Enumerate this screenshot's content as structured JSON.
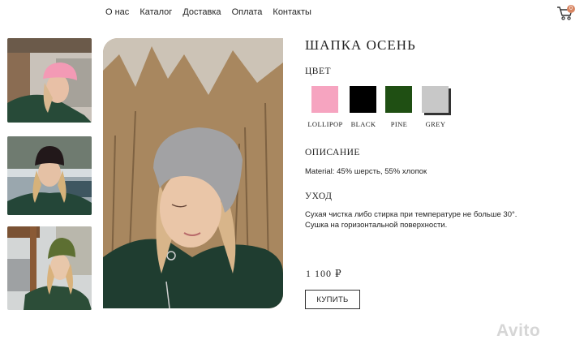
{
  "nav": {
    "items": [
      "О нас",
      "Каталог",
      "Доставка",
      "Оплата",
      "Контакты"
    ]
  },
  "cart": {
    "icon": "cart-icon",
    "count": "0"
  },
  "product": {
    "title": "ШАПКА ОСЕНЬ",
    "color_heading": "ЦВЕТ",
    "colors": [
      {
        "name": "LOLLIPOP",
        "hex": "#f6a4c0"
      },
      {
        "name": "BLACK",
        "hex": "#000000"
      },
      {
        "name": "PINE",
        "hex": "#1f4f13"
      },
      {
        "name": "GREY",
        "hex": "#c8c8c8"
      }
    ],
    "description_heading": "ОПИСАНИЕ",
    "description": "Material: 45% шерсть, 55% хлопок",
    "care_heading": "УХОД",
    "care_line1": "Сухая чистка либо стирка при температуре не больше 30°.",
    "care_line2": "Сушка на горизонтальной поверхности.",
    "price": "1 100 ₽",
    "buy_label": "КУПИТЬ"
  },
  "watermark": "Avito"
}
